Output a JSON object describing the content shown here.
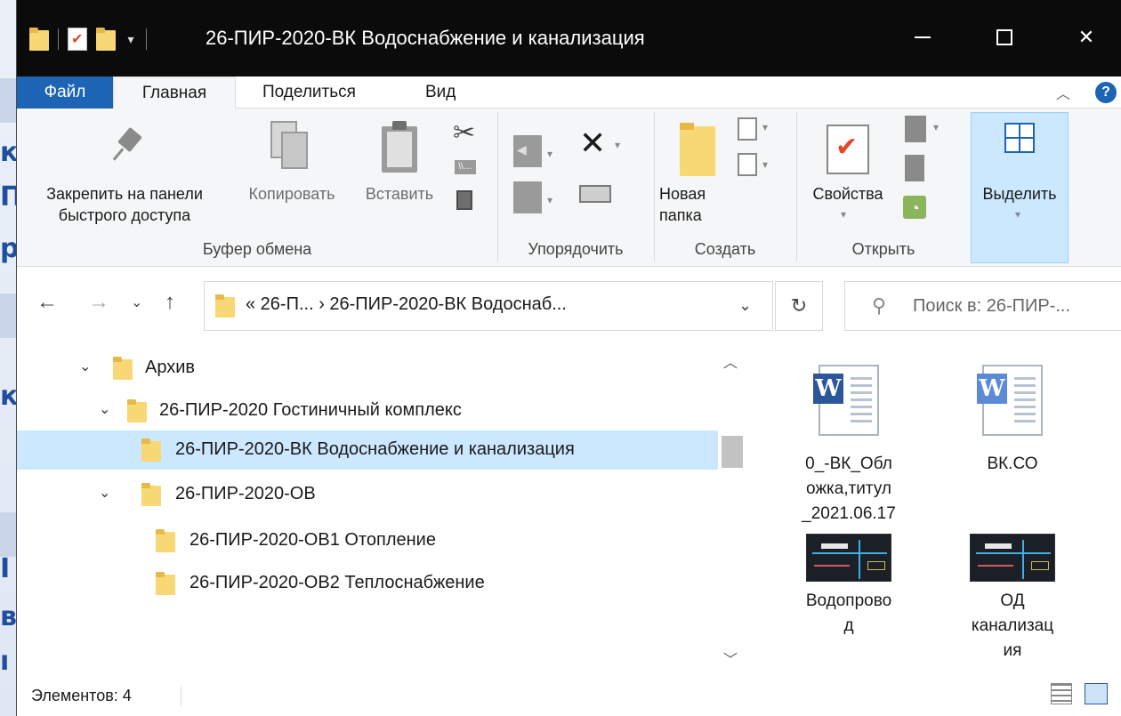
{
  "window": {
    "title": "26-ПИР-2020-ВК Водоснабжение и канализация",
    "icons": [
      "folder-icon",
      "properties-icon",
      "new-folder-icon",
      "qat-dropdown-icon"
    ]
  },
  "tabs": {
    "file": "Файл",
    "home": "Главная",
    "share": "Поделиться",
    "view": "Вид"
  },
  "ribbon": {
    "pin": "Закрепить на панели быстрого доступа",
    "pin_line1": "Закрепить на панели",
    "pin_line2": "быстрого доступа",
    "copy": "Копировать",
    "paste": "Вставить",
    "clipboard_group": "Буфер обмена",
    "organize_group": "Упорядочить",
    "new_folder_line1": "Новая",
    "new_folder_line2": "папка",
    "create_group": "Создать",
    "properties": "Свойства",
    "open_group": "Открыть",
    "select": "Выделить"
  },
  "address": {
    "crumbs": "« 26-П... › 26-ПИР-2020-ВК Водоснаб...",
    "search_placeholder": "Поиск в: 26-ПИР-..."
  },
  "tree": [
    {
      "label": "Архив",
      "expanded": true
    },
    {
      "label": "26-ПИР-2020 Гостиничный комплекс",
      "expanded": true
    },
    {
      "label": "26-ПИР-2020-ВК Водоснабжение и канализация",
      "selected": true
    },
    {
      "label": "26-ПИР-2020-ОВ",
      "expanded": true
    },
    {
      "label": "26-ПИР-2020-ОВ1 Отопление"
    },
    {
      "label": "26-ПИР-2020-ОВ2 Теплоснабжение"
    }
  ],
  "files": [
    {
      "name": "0_-ВК_Обложка,титул_2021.06.17",
      "line1": "0_-ВК_Обл",
      "line2": "ожка,титул",
      "line3": "_2021.06.17",
      "icon": "word-document-icon"
    },
    {
      "name": "ВК.СО",
      "icon": "word-document-icon"
    },
    {
      "name": "Водопровод",
      "line1": "Водопрово",
      "line2": "д",
      "icon": "cad-drawing-icon"
    },
    {
      "name": "ОД канализация",
      "line1": "ОД",
      "line2": "канализац",
      "line3": "ия",
      "icon": "cad-drawing-icon"
    }
  ],
  "status": {
    "items": "Элементов: 4"
  },
  "background_glyphs": [
    "к",
    "П",
    "р",
    "к",
    "I",
    "в",
    "ı"
  ],
  "colors": {
    "titlebar": "#0b0b0b",
    "accent": "#1e64b4",
    "selection": "#cce8ff",
    "folder": "#f8d775"
  }
}
